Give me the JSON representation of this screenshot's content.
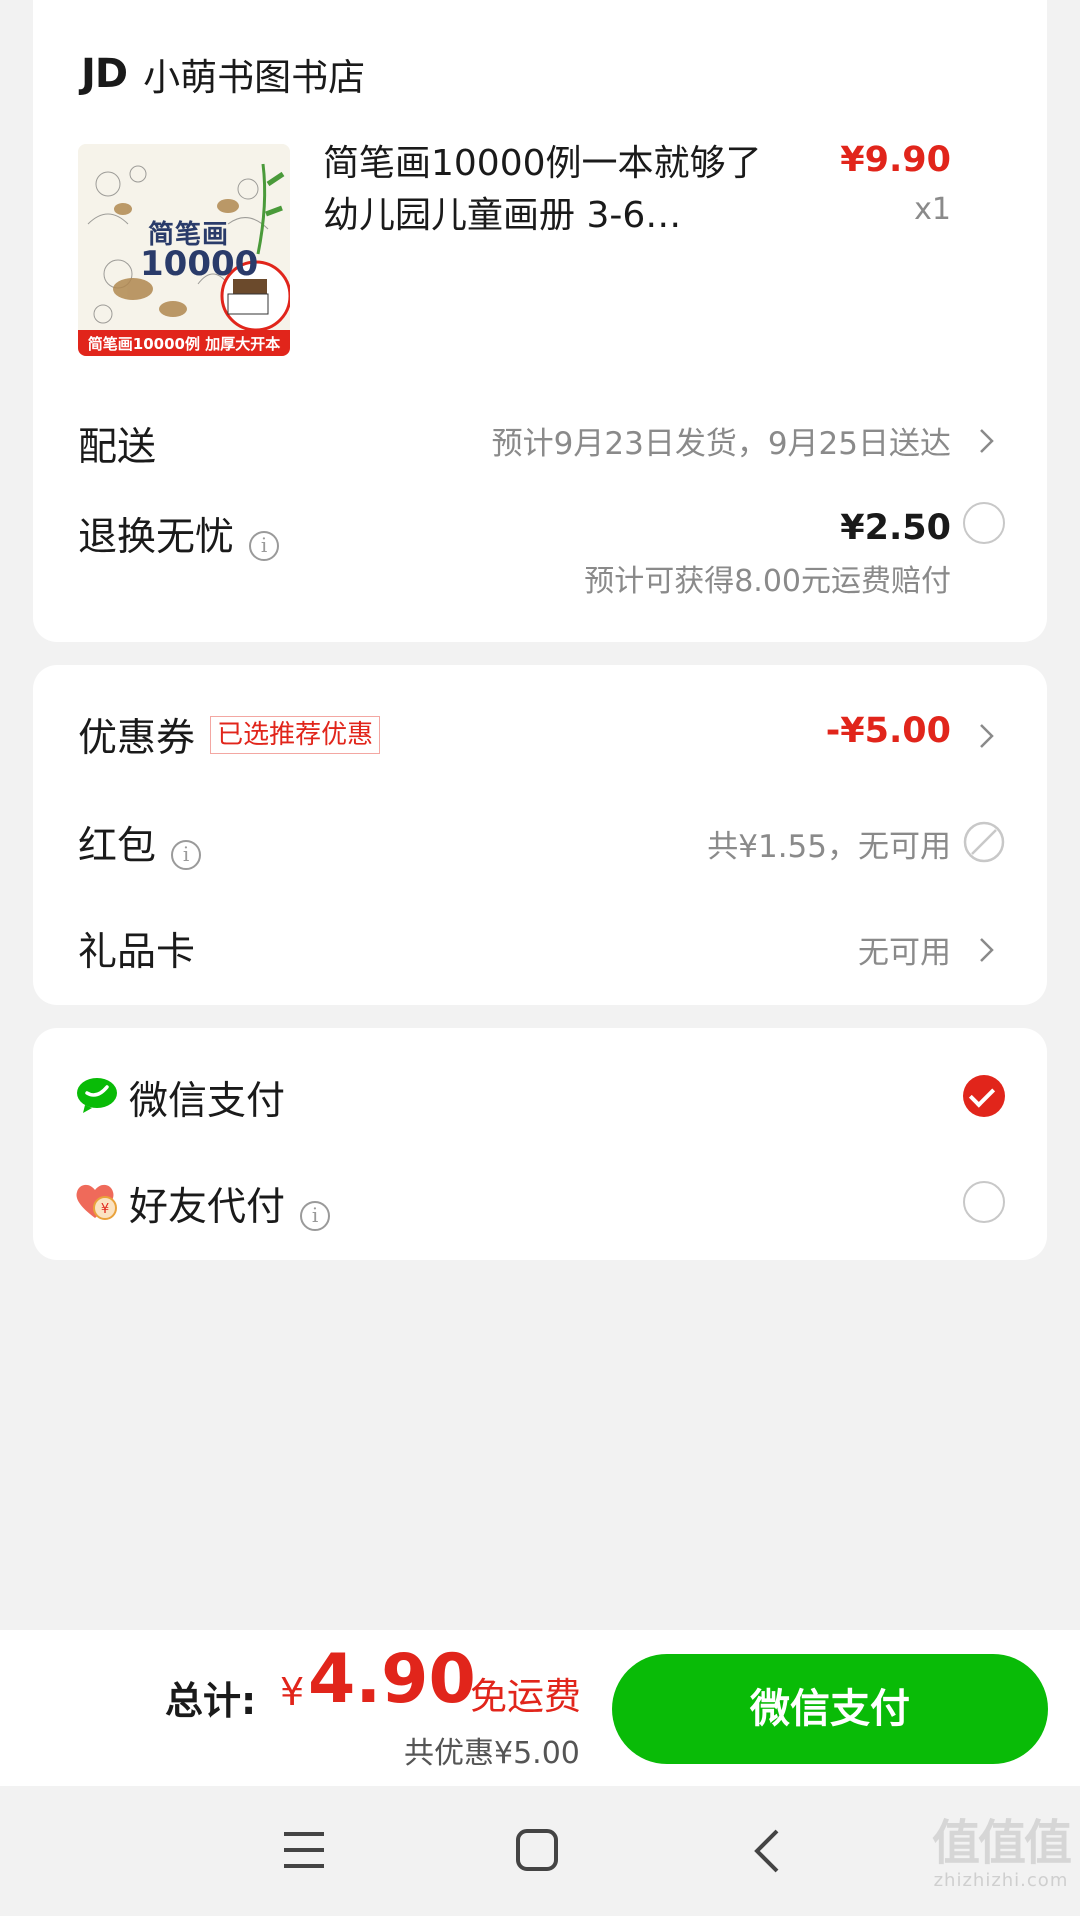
{
  "store": {
    "logo": "JD",
    "name": "小萌书图书店"
  },
  "product": {
    "image_banner": "简笔画10000例 加厚大开本",
    "image_title": "简笔画",
    "image_number": "10000",
    "title": "简笔画10000例一本就够了 幼儿园儿童画册 3-6…",
    "price": "¥9.90",
    "quantity": "x1"
  },
  "delivery": {
    "label": "配送",
    "value": "预计9月23日发货，9月25日送达"
  },
  "returns": {
    "label": "退换无忧",
    "price": "¥2.50",
    "note": "预计可获得8.00元运费赔付",
    "selected": false
  },
  "discounts": {
    "coupon": {
      "label": "优惠券",
      "badge": "已选推荐优惠",
      "value": "-¥5.00"
    },
    "red_packet": {
      "label": "红包",
      "value": "共¥1.55，无可用"
    },
    "gift_card": {
      "label": "礼品卡",
      "value": "无可用"
    }
  },
  "payment": {
    "options": [
      {
        "label": "微信支付",
        "icon": "wechat-icon",
        "selected": true
      },
      {
        "label": "好友代付",
        "icon": "friend-pay-icon",
        "selected": false
      }
    ]
  },
  "footer": {
    "total_label": "总计:",
    "currency": "¥",
    "total": "4.90",
    "shipping": "免运费",
    "saved": "共优惠¥5.00",
    "pay_button": "微信支付"
  },
  "watermark": {
    "text": "值值值",
    "domain": "zhizhizhi.com"
  },
  "colors": {
    "accent_red": "#e1251b",
    "wechat_green": "#09bb07",
    "background": "#f2f2f2"
  }
}
